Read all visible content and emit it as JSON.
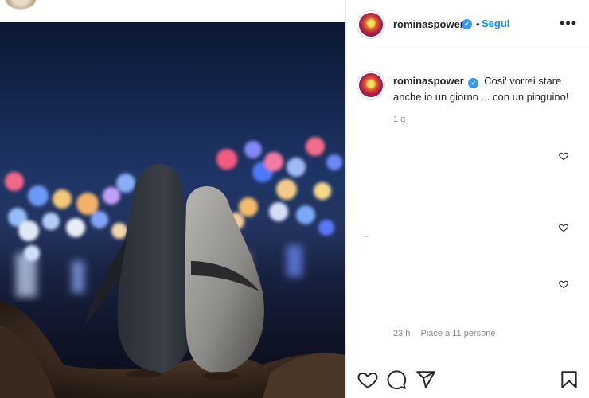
{
  "post": {
    "username": "rominaspower",
    "follow_label": "Segui",
    "more_label": "•••",
    "separator": "•",
    "verified_mark": "✓",
    "caption_text": "Cosi' vorrei stare anche io un giorno ... con un pinguino!",
    "caption_age": "1 g",
    "comment_age": "23 h",
    "likes_text": "Piace a 11 persone"
  },
  "icons": {
    "verified": "verified-badge-icon",
    "more": "more-options-icon",
    "comment_like": "heart-outline-icon",
    "like": "heart-icon",
    "comment": "comment-bubble-icon",
    "share": "paper-plane-icon",
    "save": "bookmark-icon"
  },
  "colors": {
    "accent": "#0095f6",
    "verified": "#3897f0",
    "muted_text": "#8e8e8e",
    "text": "#262626"
  }
}
